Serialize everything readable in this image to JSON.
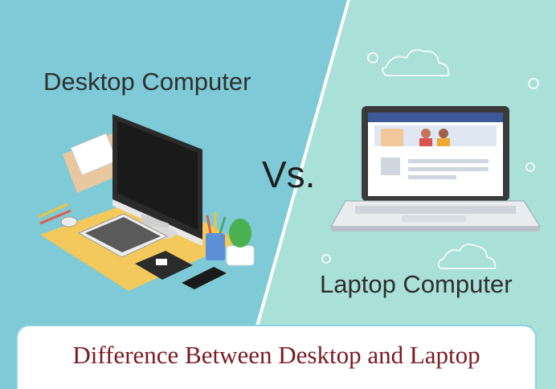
{
  "labels": {
    "desktop": "Desktop Computer",
    "laptop": "Laptop Computer",
    "versus": "Vs.",
    "banner": "Difference Between Desktop and Laptop"
  },
  "colors": {
    "left_bg": "#7ecad7",
    "right_bg": "#a9e0d8",
    "banner_text": "#7a1a22",
    "banner_border": "#8fd3e2"
  },
  "icons": [
    "desktop-monitor-icon",
    "keyboard-icon",
    "mouse-icon",
    "phone-icon",
    "cactus-icon",
    "pencil-cup-icon",
    "laptop-icon",
    "cloud-icon",
    "gear-icon"
  ]
}
